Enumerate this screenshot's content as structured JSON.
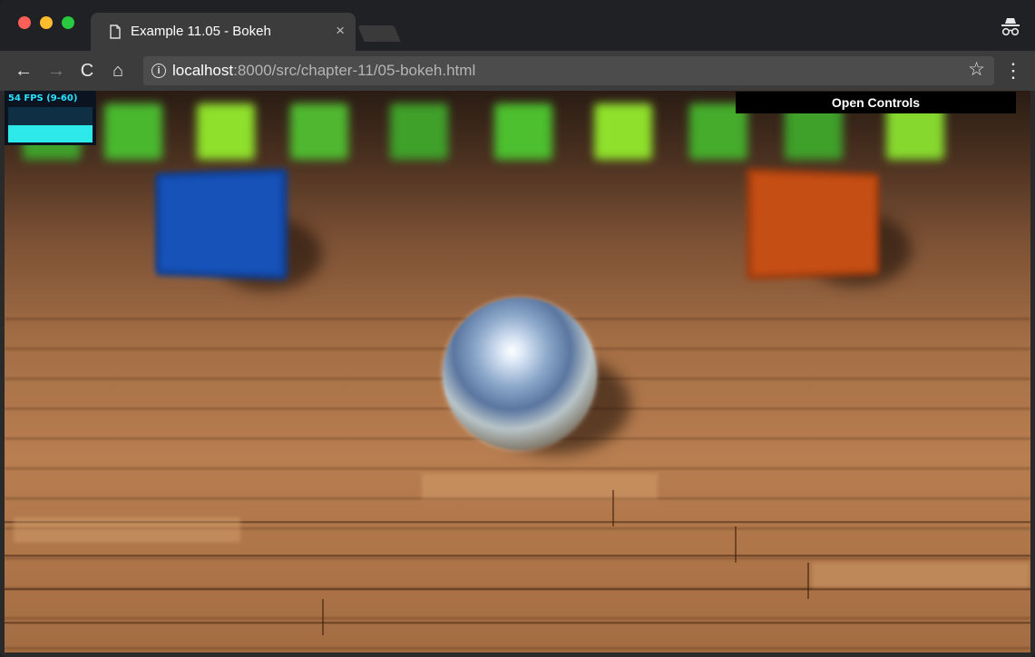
{
  "window": {
    "tab": {
      "title": "Example 11.05 - Bokeh",
      "close_glyph": "×"
    },
    "icons": [
      "close-window-icon",
      "minimize-window-icon",
      "zoom-window-icon",
      "page-icon",
      "incognito-icon"
    ]
  },
  "toolbar": {
    "back": "←",
    "forward": "→",
    "reload": "C",
    "home": "⌂",
    "info": "i",
    "url_host": "localhost",
    "url_rest": ":8000/src/chapter-11/05-bokeh.html",
    "star": "☆",
    "menu": "⋮"
  },
  "stats": {
    "fps_label": "54 FPS (9-60)",
    "fps_level": 0.5
  },
  "controls": {
    "label": "Open Controls"
  },
  "colors": {
    "accent_stats": "#29e3ff",
    "traffic_red": "#ff5f57",
    "traffic_yellow": "#febc2e",
    "traffic_green": "#28c840"
  }
}
